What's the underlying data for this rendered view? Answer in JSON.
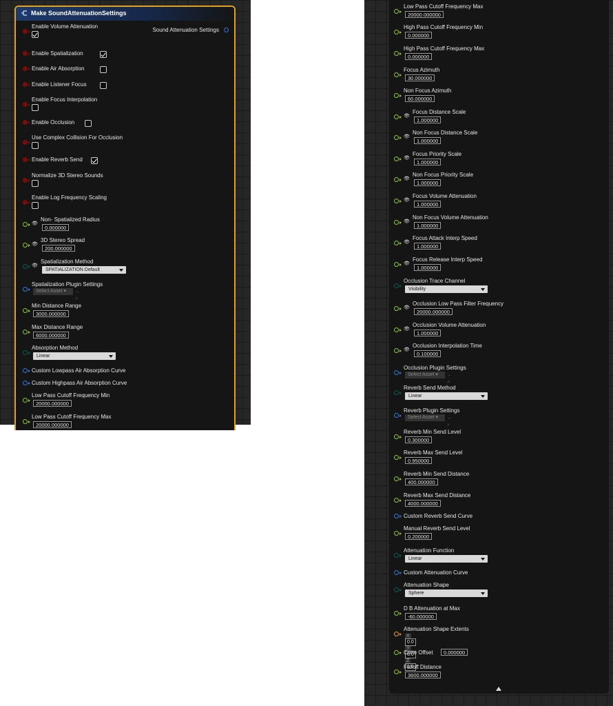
{
  "left_node": {
    "title": "Make SoundAttenuationSettings",
    "output_label": "Sound Attenuation Settings",
    "rows": [
      {
        "kind": "bool",
        "pin": "red",
        "label": "Enable Volume Attenuation",
        "checked": true,
        "wrap": true
      },
      {
        "kind": "bool",
        "pin": "red",
        "label": "Enable Spatialization",
        "checked": true
      },
      {
        "kind": "bool",
        "pin": "red",
        "label": "Enable Air Absorption",
        "checked": false
      },
      {
        "kind": "bool",
        "pin": "red",
        "label": "Enable Listener Focus",
        "checked": false
      },
      {
        "kind": "bool",
        "pin": "red",
        "label": "Enable Focus Interpolation",
        "checked": false,
        "wrap": true
      },
      {
        "kind": "bool",
        "pin": "red",
        "label": "Enable Occlusion",
        "checked": false
      },
      {
        "kind": "bool",
        "pin": "red",
        "label": "Use Complex Collision For Occlusion",
        "checked": false,
        "wrap": true
      },
      {
        "kind": "bool",
        "pin": "red",
        "label": "Enable Reverb Send",
        "checked": true
      },
      {
        "kind": "bool",
        "pin": "red",
        "label": "Normalize 3D Stereo Sounds",
        "checked": false,
        "wrap": true
      },
      {
        "kind": "bool",
        "pin": "red",
        "label": "Enable Log Frequency Scaling",
        "checked": false,
        "wrap": true
      },
      {
        "kind": "num",
        "pin": "green",
        "eye": true,
        "label": "Non- Spatialized Radius",
        "value": "0.000000"
      },
      {
        "kind": "num",
        "pin": "green",
        "eye": true,
        "label": "3D Stereo Spread",
        "value": "200.000000"
      },
      {
        "kind": "enum",
        "pin": "teal",
        "eye": true,
        "label": "Spatialization Method",
        "value": "SPATIALIZATION Default"
      },
      {
        "kind": "asset",
        "pin": "blue",
        "label": "Spatialization Plugin Settings",
        "value": "Select Asset"
      },
      {
        "kind": "num",
        "pin": "green",
        "label": "Min Distance Range",
        "value": "3000.000000"
      },
      {
        "kind": "num",
        "pin": "green",
        "label": "Max Distance Range",
        "value": "6000.000000"
      },
      {
        "kind": "enum",
        "pin": "teal",
        "label": "Absorption Method",
        "value": "Linear"
      },
      {
        "kind": "obj",
        "pin": "blue",
        "label": "Custom Lowpass Air Absorption Curve"
      },
      {
        "kind": "obj",
        "pin": "blue",
        "label": "Custom Highpass Air Absorption Curve"
      },
      {
        "kind": "num",
        "pin": "green",
        "label": "Low Pass Cutoff Frequency Min",
        "value": "20000.000000"
      },
      {
        "kind": "num",
        "pin": "green",
        "label": "Low Pass Cutoff Frequency Max",
        "value": "20000.000000"
      }
    ]
  },
  "right_node": {
    "rows": [
      {
        "kind": "num",
        "pin": "green",
        "label": "Low Pass Cutoff Frequency Max",
        "value": "20000.000000"
      },
      {
        "kind": "num",
        "pin": "green",
        "label": "High Pass Cutoff Frequency Min",
        "value": "0.000000"
      },
      {
        "kind": "num",
        "pin": "green",
        "label": "High Pass Cutoff Frequency Max",
        "value": "0.000000"
      },
      {
        "kind": "num",
        "pin": "green",
        "label": "Focus Azimuth",
        "value": "30.000000"
      },
      {
        "kind": "num",
        "pin": "green",
        "label": "Non Focus Azimuth",
        "value": "60.000000"
      },
      {
        "kind": "num",
        "pin": "green",
        "eye": true,
        "label": "Focus Distance Scale",
        "value": "1.000000"
      },
      {
        "kind": "num",
        "pin": "green",
        "eye": true,
        "label": "Non Focus Distance Scale",
        "value": "1.000000"
      },
      {
        "kind": "num",
        "pin": "green",
        "eye": true,
        "label": "Focus Priority Scale",
        "value": "1.000000"
      },
      {
        "kind": "num",
        "pin": "green",
        "eye": true,
        "label": "Non Focus Priority Scale",
        "value": "1.000000"
      },
      {
        "kind": "num",
        "pin": "green",
        "eye": true,
        "label": "Focus Volume Attenuation",
        "value": "1.000000"
      },
      {
        "kind": "num",
        "pin": "green",
        "eye": true,
        "label": "Non Focus Volume Attenuation",
        "value": "1.000000"
      },
      {
        "kind": "num",
        "pin": "green",
        "eye": true,
        "label": "Focus Attack Interp Speed",
        "value": "1.000000"
      },
      {
        "kind": "num",
        "pin": "green",
        "eye": true,
        "label": "Focus Release Interp Speed",
        "value": "1.000000"
      },
      {
        "kind": "enum",
        "pin": "teal",
        "label": "Occlusion Trace Channel",
        "value": "Visibility"
      },
      {
        "kind": "num",
        "pin": "green",
        "eye": true,
        "label": "Occlusion Low Pass Filter Frequency",
        "value": "20000.000000"
      },
      {
        "kind": "num",
        "pin": "green",
        "eye": true,
        "label": "Occlusion Volume Attenuation",
        "value": "1.000000"
      },
      {
        "kind": "num",
        "pin": "green",
        "eye": true,
        "label": "Occlusion Interpolation Time",
        "value": "0.100000"
      },
      {
        "kind": "asset",
        "pin": "blue",
        "label": "Occlusion Plugin Settings",
        "value": "Select Asset"
      },
      {
        "kind": "enum",
        "pin": "teal",
        "label": "Reverb Send Method",
        "value": "Linear"
      },
      {
        "kind": "asset",
        "pin": "blue",
        "label": "Reverb Plugin Settings",
        "value": "Select Asset"
      },
      {
        "kind": "num",
        "pin": "green",
        "label": "Reverb Min Send Level",
        "value": "0.300000"
      },
      {
        "kind": "num",
        "pin": "green",
        "label": "Reverb Max Send Level",
        "value": "0.950000"
      },
      {
        "kind": "num",
        "pin": "green",
        "label": "Reverb Min Send Distance",
        "value": "400.000000"
      },
      {
        "kind": "num",
        "pin": "green",
        "label": "Reverb Max Send Distance",
        "value": "4000.000000"
      },
      {
        "kind": "obj",
        "pin": "blue",
        "label": "Custom Reverb Send Curve"
      },
      {
        "kind": "num",
        "pin": "green",
        "label": "Manual Reverb Send Level",
        "value": "0.200000"
      },
      {
        "kind": "enum",
        "pin": "teal",
        "label": "Attenuation Function",
        "value": "Linear"
      },
      {
        "kind": "obj",
        "pin": "blue",
        "label": "Custom Attenuation Curve"
      },
      {
        "kind": "enum",
        "pin": "teal",
        "label": "Attenuation Shape",
        "value": "Sphere"
      },
      {
        "kind": "num",
        "pin": "green",
        "label": "D B Attenuation at Max",
        "value": "-60.000000"
      },
      {
        "kind": "vec",
        "pin": "orange",
        "label": "Attenuation Shape Extents",
        "x": "0.0",
        "y": "0.0",
        "z": "0.0"
      },
      {
        "kind": "inline",
        "pin": "green",
        "label": "Cone Offset",
        "value": "0.000000"
      },
      {
        "kind": "num",
        "pin": "green",
        "label": "Falloff Distance",
        "value": "3600.000000"
      }
    ]
  }
}
